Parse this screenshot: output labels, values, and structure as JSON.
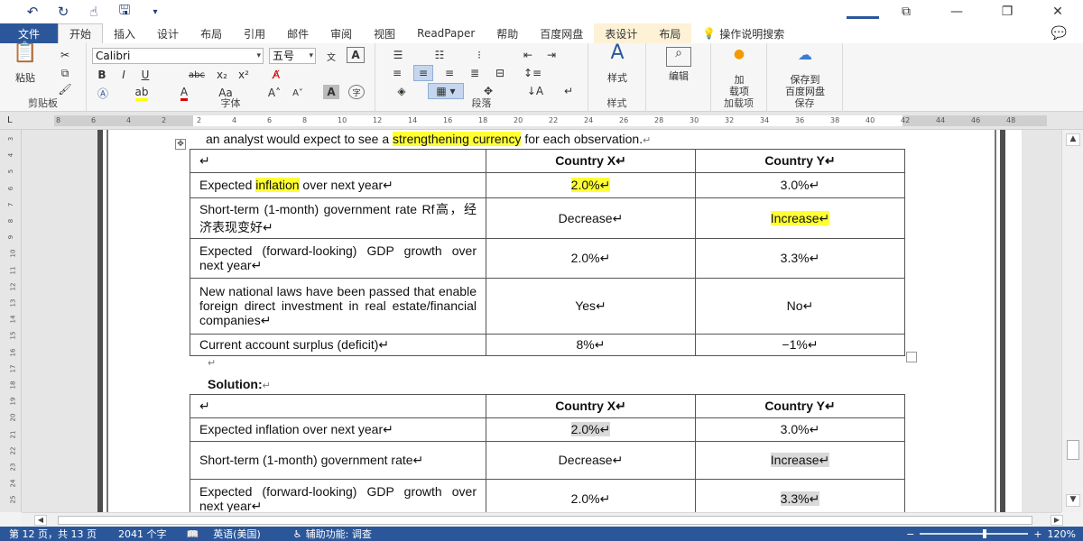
{
  "qat": {
    "undo_icon": "undo-icon",
    "redo_icon": "redo-icon",
    "touch_icon": "touch-mode-icon",
    "save_icon": "save-icon",
    "customize_icon": "chevron-down-icon"
  },
  "window": {
    "restore": "⧉",
    "minimize": "—",
    "maximize": "❐",
    "close": "✕"
  },
  "tabs": {
    "file": "文件",
    "items": [
      "开始",
      "插入",
      "设计",
      "布局",
      "引用",
      "邮件",
      "审阅",
      "视图",
      "ReadPaper",
      "帮助",
      "百度网盘"
    ],
    "contextual": [
      "表设计",
      "布局"
    ],
    "tell_me": "操作说明搜索",
    "active": "开始"
  },
  "ribbon": {
    "clipboard": {
      "paste": "粘贴",
      "label": "剪贴板"
    },
    "font": {
      "name": "Calibri",
      "size": "五号",
      "label": "字体",
      "bold": "B",
      "italic": "I",
      "underline": "U",
      "strike": "abc",
      "subscript": "x₂",
      "superscript": "x²",
      "change_case": "Aa",
      "grow": "A˄",
      "shrink": "A˅",
      "wen": "文"
    },
    "paragraph": {
      "label": "段落"
    },
    "styles": {
      "button": "样式",
      "label": "样式"
    },
    "editing": {
      "button": "编辑"
    },
    "addins": {
      "button_line1": "加",
      "button_line2": "载项",
      "label": "加载项"
    },
    "save": {
      "button_line1": "保存到",
      "button_line2": "百度网盘",
      "label": "保存"
    }
  },
  "ruler": {
    "ticks": [
      "8",
      "6",
      "4",
      "2",
      "2",
      "4",
      "6",
      "8",
      "10",
      "12",
      "14",
      "16",
      "18",
      "20",
      "22",
      "24",
      "26",
      "28",
      "30",
      "32",
      "34",
      "36",
      "38",
      "40",
      "42",
      "44",
      "46",
      "48"
    ],
    "vticks": [
      "3",
      "4",
      "5",
      "6",
      "7",
      "8",
      "9",
      "10",
      "11",
      "12",
      "13",
      "14",
      "15",
      "16",
      "17",
      "18",
      "19",
      "20",
      "21",
      "22",
      "23",
      "24",
      "25"
    ]
  },
  "document": {
    "intro_pre": "an analyst would expect to see a ",
    "intro_hl": "strengthening currency",
    "intro_post": " for each observation.",
    "para_mark": "↵",
    "solution_label": "Solution:",
    "table1": {
      "header": [
        "↵",
        "Country X↵",
        "Country Y↵"
      ],
      "rows": [
        {
          "pre": "Expected ",
          "hl": "inflation",
          "post": " over next year↵",
          "x": "2.0%↵",
          "y": "3.0%↵"
        },
        {
          "label": "Short-term (1-month) government rate Rf高，经济表现变好↵",
          "x": "Decrease↵",
          "y": "Increase↵"
        },
        {
          "label": "Expected (forward-looking) GDP growth over next year↵",
          "x": "2.0%↵",
          "y": "3.3%↵"
        },
        {
          "label": "New national laws have been passed that enable foreign direct investment in real estate/financial companies↵",
          "x": "Yes↵",
          "y": "No↵"
        },
        {
          "label": "Current account surplus (deficit)↵",
          "x": "8%↵",
          "y": "−1%↵"
        }
      ]
    },
    "table2": {
      "header": [
        "↵",
        "Country X↵",
        "Country Y↵"
      ],
      "rows": [
        {
          "label": "Expected inflation over next year↵",
          "x": "2.0%↵",
          "y": "3.0%↵"
        },
        {
          "label": "Short-term (1-month) government rate↵",
          "x": "Decrease↵",
          "y": "Increase↵"
        },
        {
          "label": "Expected (forward-looking) GDP growth over next year↵",
          "x": "2.0%↵",
          "y": "3.3%↵"
        }
      ]
    }
  },
  "status": {
    "page": "第 12 页，共 13 页",
    "words": "2041 个字",
    "language": "英语(美国)",
    "accessibility": "辅助功能: 调查",
    "zoom": "120%",
    "zoom_fraction": 0.6
  },
  "colors": {
    "accent": "#2b579a",
    "highlight": "#ffff33",
    "shade": "#d9d9d9"
  }
}
